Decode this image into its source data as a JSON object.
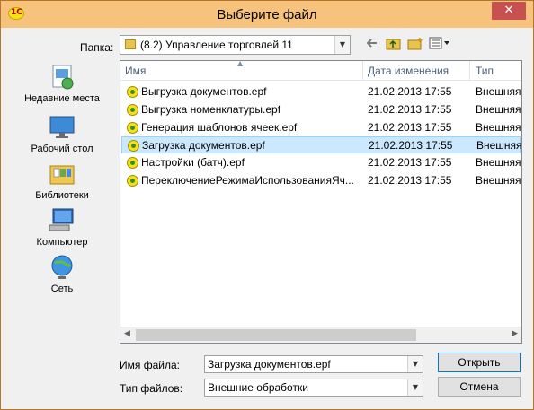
{
  "window": {
    "title": "Выберите файл",
    "close_glyph": "✕"
  },
  "folder": {
    "label": "Папка:",
    "value": "(8.2) Управление торговлей 11"
  },
  "toolbar": {
    "icons": [
      "back-arrow-icon",
      "up-folder-icon",
      "new-folder-icon",
      "view-menu-icon"
    ]
  },
  "places": [
    {
      "label": "Недавние места",
      "icon": "recent-places-icon"
    },
    {
      "label": "Рабочий стол",
      "icon": "desktop-icon"
    },
    {
      "label": "Библиотеки",
      "icon": "libraries-icon"
    },
    {
      "label": "Компьютер",
      "icon": "computer-icon"
    },
    {
      "label": "Сеть",
      "icon": "network-icon"
    }
  ],
  "columns": {
    "name": "Имя",
    "date": "Дата изменения",
    "type": "Тип"
  },
  "files": [
    {
      "name": "Выгрузка документов.epf",
      "date": "21.02.2013 17:55",
      "type": "Внешняя"
    },
    {
      "name": "Выгрузка номенклатуры.epf",
      "date": "21.02.2013 17:55",
      "type": "Внешняя"
    },
    {
      "name": "Генерация шаблонов ячеек.epf",
      "date": "21.02.2013 17:55",
      "type": "Внешняя"
    },
    {
      "name": "Загрузка документов.epf",
      "date": "21.02.2013 17:55",
      "type": "Внешняя",
      "selected": true
    },
    {
      "name": "Настройки (батч).epf",
      "date": "21.02.2013 17:55",
      "type": "Внешняя"
    },
    {
      "name": "ПереключениеРежимаИспользованияЯч...",
      "date": "21.02.2013 17:55",
      "type": "Внешняя"
    }
  ],
  "filename": {
    "label": "Имя файла:",
    "value": "Загрузка документов.epf"
  },
  "filetype": {
    "label": "Тип файлов:",
    "value": "Внешние обработки"
  },
  "buttons": {
    "open": "Открыть",
    "cancel": "Отмена"
  }
}
